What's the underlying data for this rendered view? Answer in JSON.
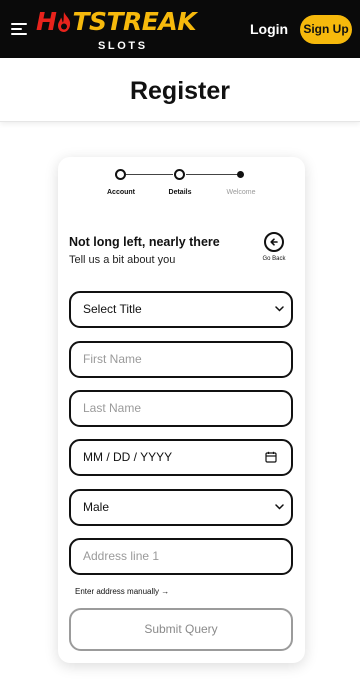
{
  "topbar": {
    "logo_main_hot": "H",
    "logo_main_rest": "TSTREAK",
    "logo_sub": "SLOTS",
    "login_label": "Login",
    "signup_label": "Sign Up"
  },
  "page": {
    "title": "Register"
  },
  "stepper": {
    "steps": [
      {
        "label": "Account",
        "state": "done"
      },
      {
        "label": "Details",
        "state": "active"
      },
      {
        "label": "Welcome",
        "state": "upcoming"
      }
    ]
  },
  "intro": {
    "headline": "Not long left, nearly there",
    "subline": "Tell us a bit about you",
    "go_back_label": "Go Back"
  },
  "form": {
    "title_select": {
      "value": "Select Title"
    },
    "first_name": {
      "placeholder": "First Name",
      "value": ""
    },
    "last_name": {
      "placeholder": "Last Name",
      "value": ""
    },
    "dob": {
      "placeholder": "MM / DD / YYYY"
    },
    "gender_select": {
      "value": "Male"
    },
    "address": {
      "placeholder": "Address line 1",
      "value": ""
    },
    "manual_address_link": "Enter address manually →",
    "submit_label": "Submit Query"
  },
  "colors": {
    "brand_red": "#e8231c",
    "brand_yellow": "#f6b90c",
    "topbar_bg": "#0a0a0a"
  },
  "icons": [
    "hamburger-menu-icon",
    "fire-icon",
    "arrow-left-icon",
    "chevron-down-icon",
    "calendar-icon"
  ]
}
